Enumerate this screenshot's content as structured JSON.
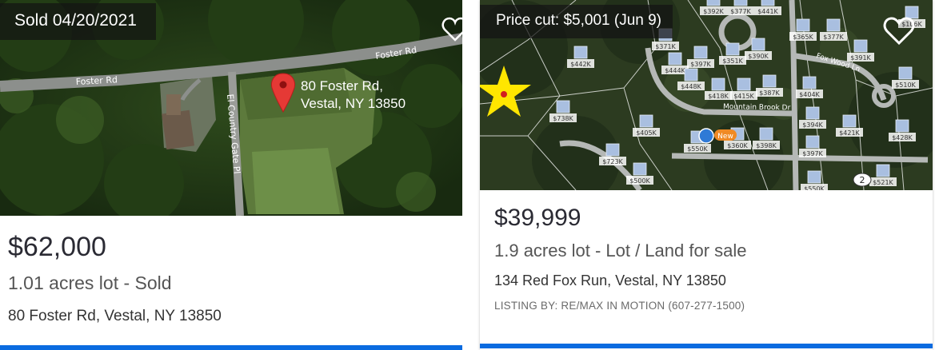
{
  "listings": [
    {
      "badge": "Sold 04/20/2021",
      "price": "$62,000",
      "lot": "1.01 acres lot  - Sold",
      "address": "80 Foster Rd, Vestal, NY 13850",
      "map": {
        "pin_label_line1": "80 Foster Rd,",
        "pin_label_line2": "Vestal, NY 13850",
        "road1": "Foster Rd",
        "road2": "Foster Rd",
        "road3": "El Country Gate Pl"
      }
    },
    {
      "badge": "Price cut: $5,001 (Jun 9)",
      "price": "$39,999",
      "lot": "1.9 acres lot  - Lot / Land for sale",
      "address": "134 Red Fox Run, Vestal, NY 13850",
      "listing_by": "LISTING BY: RE/MAX IN MOTION (607-277-1500)",
      "map": {
        "road_mountain_brook": "Mountain Brook Dr",
        "road_fox_wood": "Fox Wood Ln",
        "cluster_count": "2",
        "new_tag": "New",
        "price_markers": [
          "$392K",
          "$377K",
          "$441K",
          "$365K",
          "$377K",
          "$391K",
          "$442K",
          "$371K",
          "$397K",
          "$351K",
          "$390K",
          "$444K",
          "$448K",
          "$418K",
          "$415K",
          "$387K",
          "$404K",
          "$510K",
          "$738K",
          "$405K",
          "$394K",
          "$421K",
          "$428K",
          "$550K",
          "$360K",
          "$398K",
          "$397K",
          "$723K",
          "$500K",
          "$550K",
          "$521K",
          "$106K"
        ]
      }
    }
  ],
  "colors": {
    "accent_bar": "#0a6be0",
    "pin": "#e53935",
    "star": "#ffe600"
  }
}
